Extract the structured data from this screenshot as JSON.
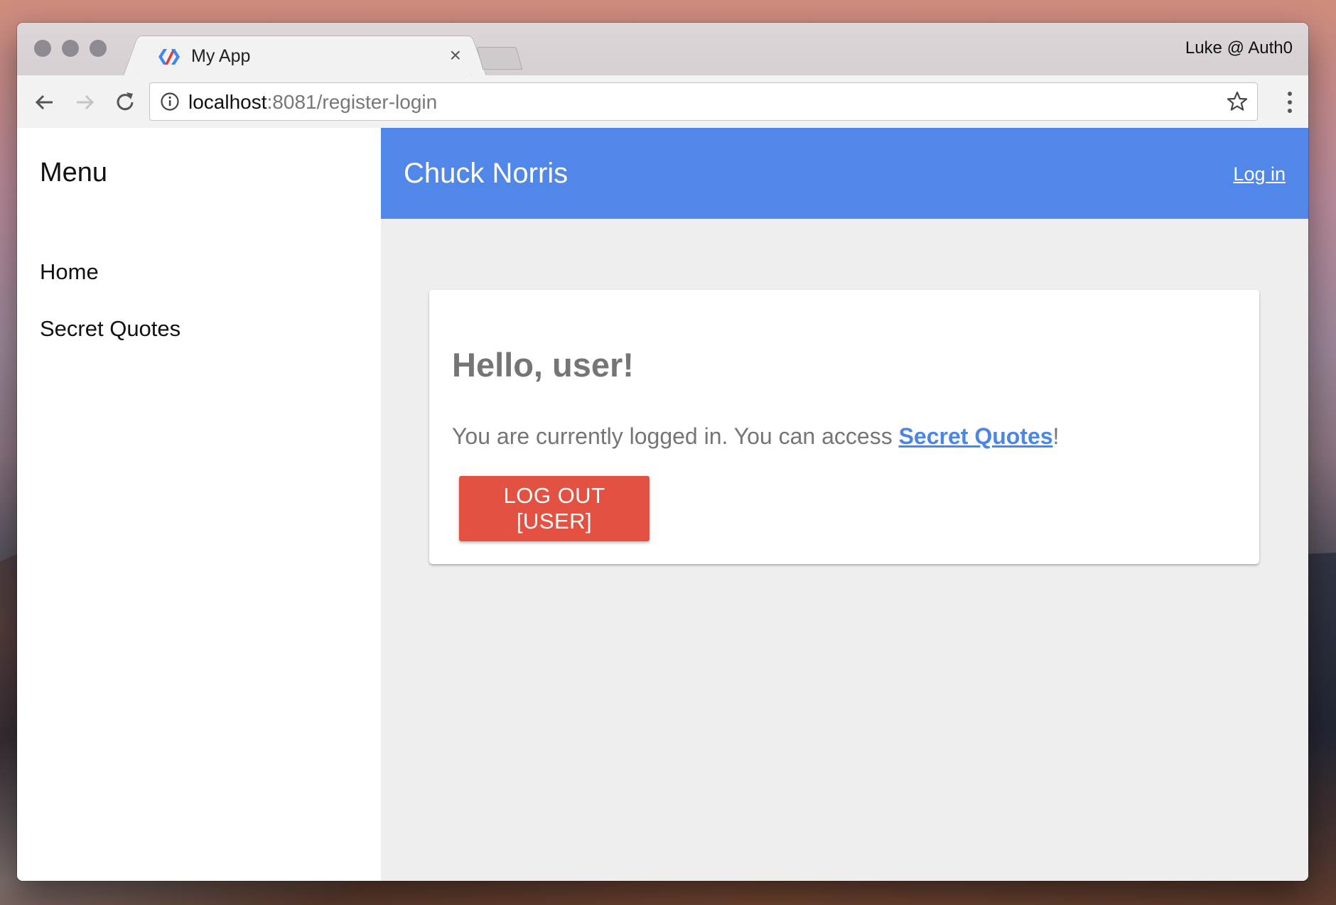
{
  "browser": {
    "tab_title": "My App",
    "tab_close": "×",
    "profile": "Luke @ Auth0",
    "url_host": "localhost",
    "url_rest": ":8081/register-login"
  },
  "icons": [
    "back-arrow-icon",
    "forward-arrow-icon",
    "reload-icon",
    "info-icon",
    "star-icon",
    "menu-dots-icon",
    "polymer-favicon"
  ],
  "drawer": {
    "title": "Menu",
    "items": [
      {
        "label": "Home"
      },
      {
        "label": "Secret Quotes"
      }
    ]
  },
  "appbar": {
    "title": "Chuck Norris",
    "login_label": "Log in",
    "color": "#5087e8"
  },
  "card": {
    "heading": "Hello, user!",
    "text_before": "You are currently logged in. You can access ",
    "link_label": "Secret Quotes",
    "text_after": "!",
    "logout_label": "LOG OUT [USER]",
    "logout_color": "#e25142",
    "link_color": "#4b86e6"
  }
}
